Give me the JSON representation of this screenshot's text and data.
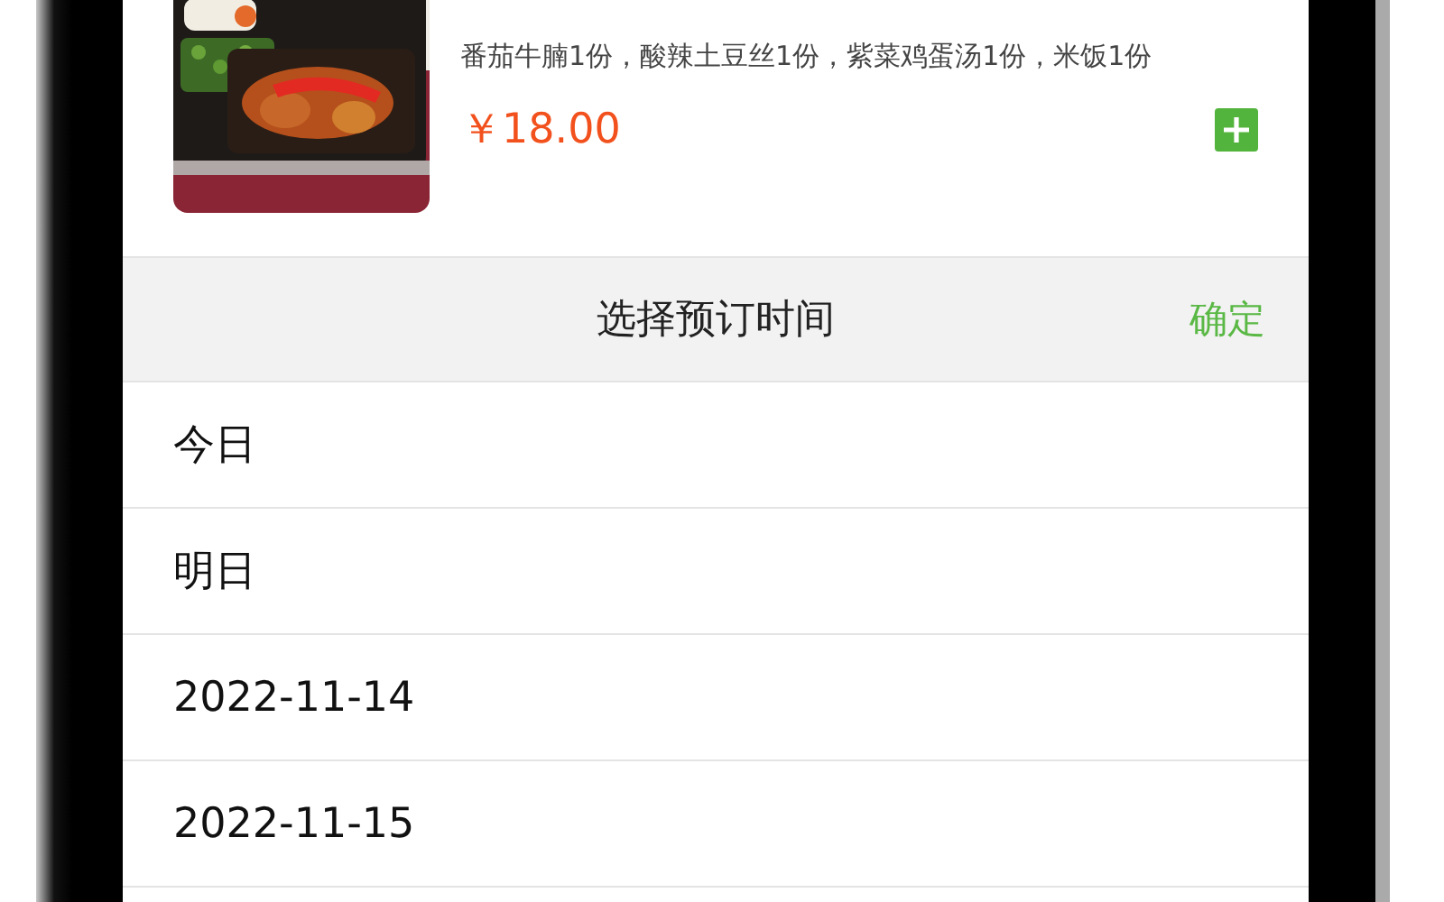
{
  "product": {
    "kind": "picture",
    "description": "番茄牛腩1份，酸辣土豆丝1份，紫菜鸡蛋汤1份，米饭1份",
    "price": "￥18.00"
  },
  "picker": {
    "title": "选择预订时间",
    "confirm": "确定",
    "options": [
      {
        "label": "今日"
      },
      {
        "label": "明日"
      },
      {
        "label": "2022-11-14"
      },
      {
        "label": "2022-11-15"
      }
    ]
  }
}
